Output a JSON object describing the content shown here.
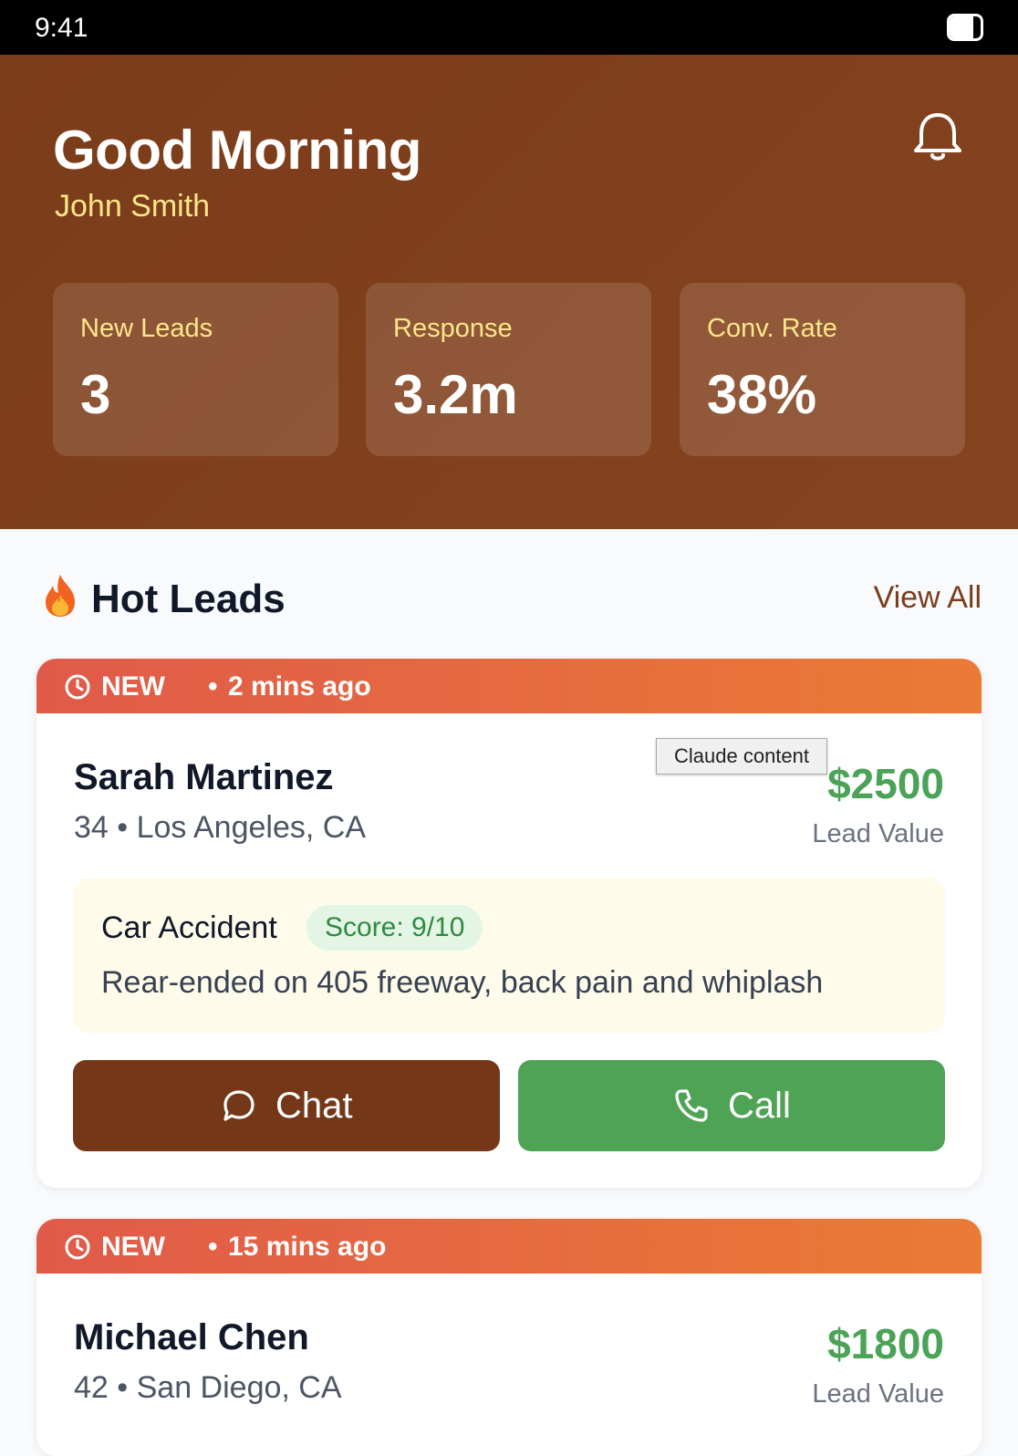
{
  "status_bar": {
    "time": "9:41",
    "battery_level": 0.75
  },
  "header": {
    "greeting": "Good Morning",
    "user_name": "John Smith",
    "notification_icon": "bell-icon",
    "stats": [
      {
        "label": "New Leads",
        "value": "3"
      },
      {
        "label": "Response",
        "value": "3.2m"
      },
      {
        "label": "Conv. Rate",
        "value": "38%"
      }
    ]
  },
  "hot_leads": {
    "icon": "fire-icon",
    "title": "Hot Leads",
    "view_all": "View All"
  },
  "leads": [
    {
      "status": "NEW",
      "separator": "•",
      "time_ago": "2 mins ago",
      "name": "Sarah Martinez",
      "meta": "34 • Los Angeles, CA",
      "value": "$2500",
      "value_label": "Lead Value",
      "case_type": "Car Accident",
      "score": "Score: 9/10",
      "description": "Rear-ended on 405 freeway, back pain and whiplash",
      "chat_label": "Chat",
      "call_label": "Call"
    },
    {
      "status": "NEW",
      "separator": "•",
      "time_ago": "15 mins ago",
      "name": "Michael Chen",
      "meta": "42 • San Diego, CA",
      "value": "$1800",
      "value_label": "Lead Value"
    }
  ],
  "tooltip": "Claude content",
  "colors": {
    "header": "#7b3c1a",
    "accent": "#fde68a",
    "chat": "#743819",
    "call": "#4ea355",
    "value": "#4aa356",
    "banner_start": "#e05a4a",
    "banner_end": "#ea7b35"
  }
}
